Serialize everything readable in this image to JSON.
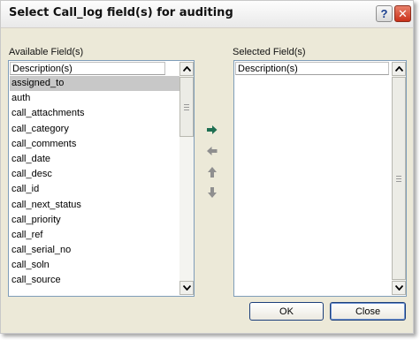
{
  "window": {
    "title": "Select Call_log field(s) for auditing",
    "help_glyph": "?",
    "close_glyph": "✕"
  },
  "available": {
    "label": "Available Field(s)",
    "header": "Description(s)",
    "selected_item": "assigned_to",
    "items": [
      "assigned_to",
      "auth",
      "call_attachments",
      "call_category",
      "call_comments",
      "call_date",
      "call_desc",
      "call_id",
      "call_next_status",
      "call_priority",
      "call_ref",
      "call_serial_no",
      "call_soln",
      "call_source"
    ]
  },
  "selected": {
    "label": "Selected Field(s)",
    "header": "Description(s)",
    "items": []
  },
  "transfer": {
    "add": "add-icon",
    "remove": "remove-icon",
    "move_up": "move-up-icon",
    "move_down": "move-down-icon"
  },
  "buttons": {
    "ok": "OK",
    "close": "Close"
  },
  "colors": {
    "add_arrow": "#1f6f52",
    "other_arrows": "#8f8f8f",
    "selection": "#c8c8c8",
    "list_border": "#7f9db9"
  }
}
